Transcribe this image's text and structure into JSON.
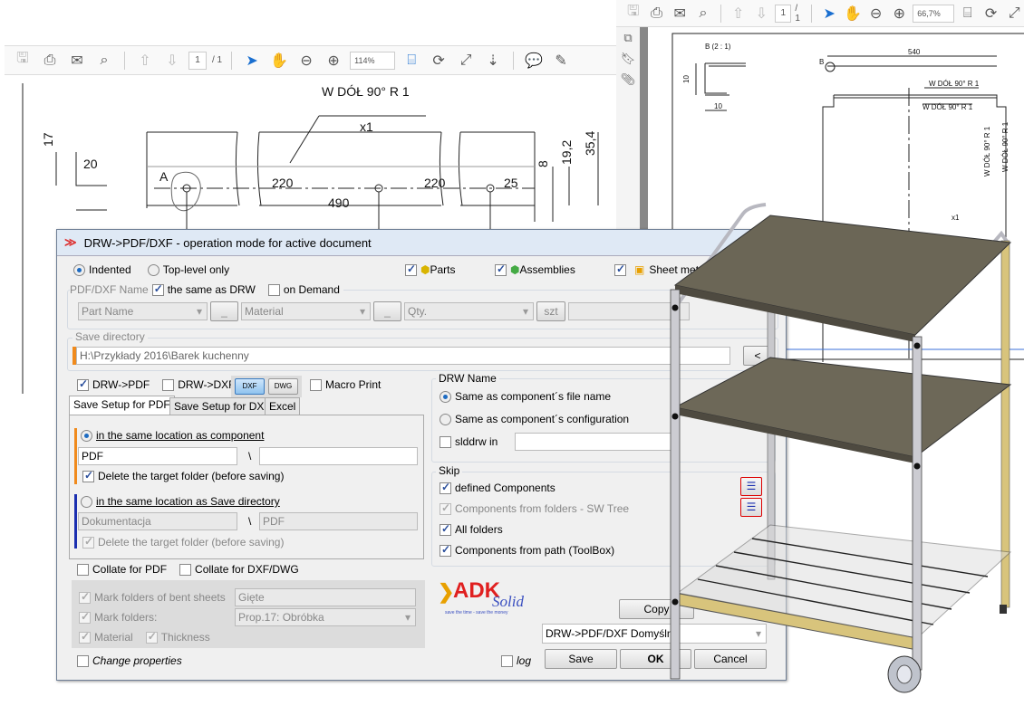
{
  "left_viewer": {
    "page": "1",
    "page_total": "/ 1",
    "zoom": "114%",
    "drawing": {
      "note": "W DÓŁ  90°  R 1",
      "qty": "x1",
      "dim_17": "17",
      "dim_20": "20",
      "dim_220a": "220",
      "dim_220b": "220",
      "dim_25": "25",
      "dim_490": "490",
      "dim_35_4": "35,4",
      "dim_19_2": "19,2",
      "dim_8": "8",
      "detail": "A"
    }
  },
  "right_viewer": {
    "page": "1",
    "page_total": "/ 1",
    "zoom": "66,7%",
    "drawing": {
      "detail_title": "B (2 : 1)",
      "dim_10a": "10",
      "dim_10b": "10",
      "dim_540": "540",
      "detail_mark": "B",
      "note1": "W DÓŁ  90°  R 1",
      "note2": "W DÓŁ  90°  R 1",
      "note3": "W DÓŁ  90°  R 1",
      "note4": "W DÓŁ  90°  R 1",
      "qty": "x1"
    }
  },
  "dialog": {
    "title": "DRW->PDF/DXF  - operation mode for active document",
    "mode": {
      "indented": "Indented",
      "top_level": "Top-level only"
    },
    "types": {
      "parts": "Parts",
      "assemblies": "Assemblies",
      "sheet_metal": "Sheet metal"
    },
    "name_group": {
      "legend": "PDF/DXF Name",
      "same_as_drw": "the same as DRW",
      "on_demand": "on Demand",
      "field1": "Part Name",
      "sep1": "_",
      "field2": "Material",
      "sep2": "_",
      "field3": "Qty.",
      "unit": "szt"
    },
    "save_dir": {
      "legend": "Save directory",
      "path": "H:\\Przykłady 2016\\Barek kuchenny",
      "browse": "<"
    },
    "outputs": {
      "drw_pdf": "DRW->PDF",
      "drw_dxf": "DRW->DXF",
      "dxf": "DXF",
      "dwg": "DWG",
      "macro_print": "Macro Print"
    },
    "tabs": [
      "Save Setup for PDF",
      "Save Setup for DXF",
      "Excel"
    ],
    "pdf_setup": {
      "opt1": "in the same location as component",
      "opt1_folder": "PDF",
      "opt1_sub": "",
      "slash": "\\",
      "delete1": "Delete the target folder (before saving)",
      "opt2": "in the same location as Save directory",
      "opt2_folder": "Dokumentacja",
      "opt2_sub": "PDF",
      "delete2": "Delete the target folder (before saving)"
    },
    "drw_name": {
      "legend": "DRW Name",
      "opt1": "Same as component´s file name",
      "opt2": "Same as component´s configuration",
      "slddrw": "slddrw in",
      "slddrw_value": ""
    },
    "skip": {
      "legend": "Skip",
      "defined": "defined Components",
      "folders_tree": "Components from folders - SW Tree",
      "all_folders": "All folders",
      "toolbox": "Components from path (ToolBox)"
    },
    "collate_pdf": "Collate for PDF",
    "collate_dxf": "Collate for DXF/DWG",
    "marks": {
      "bent": "Mark folders of bent sheets",
      "bent_value": "Gięte",
      "folders": "Mark folders:",
      "folders_value": "Prop.17: Obróbka",
      "material": "Material",
      "thickness": "Thickness"
    },
    "change_props": "Change properties",
    "log": "log",
    "logo": {
      "main": "ADK",
      "sub": "Solid",
      "tagline": "save the time - save the money"
    },
    "copy": "Copy",
    "profile": "DRW->PDF/DXF Domyślne",
    "save": "Save",
    "ok": "OK",
    "cancel": "Cancel"
  },
  "colors": {
    "accent_orange": "#f08a1c",
    "accent_blue": "#1b2fb0",
    "shelf": "#6b6656"
  }
}
